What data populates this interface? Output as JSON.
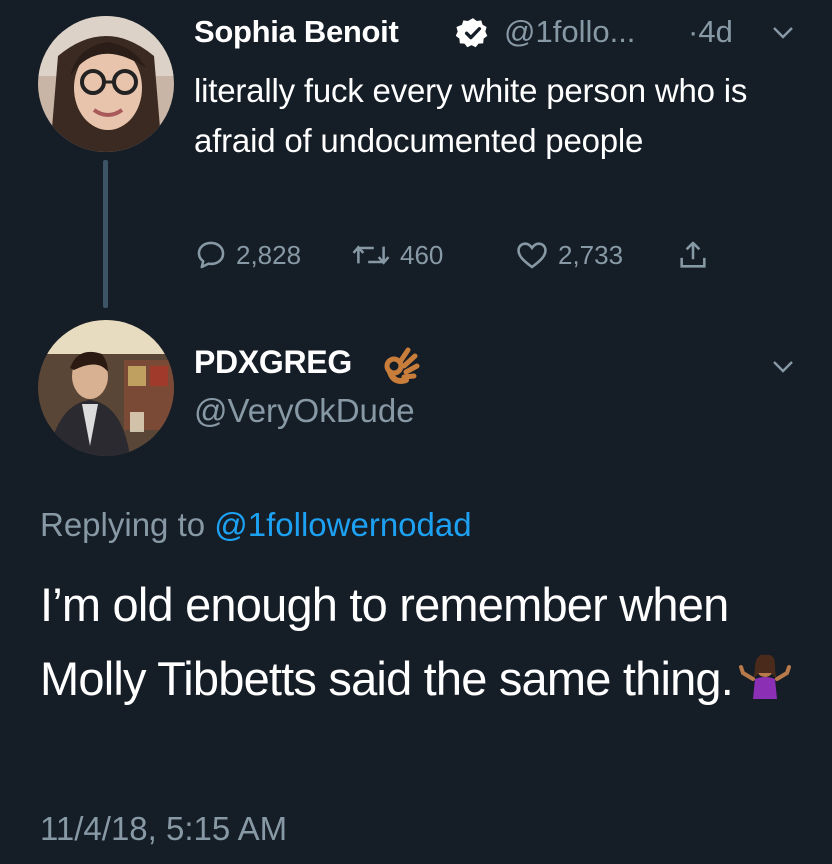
{
  "original_tweet": {
    "author_name": "Sophia Benoit",
    "handle": "@1follo...",
    "time": "·4d",
    "text": "literally fuck every white person who is afraid of undocumented people",
    "replies": "2,828",
    "retweets": "460",
    "likes": "2,733",
    "avatar_icon": "avatar-woman-glasses",
    "verified_icon": "verified-badge-icon"
  },
  "reply_tweet": {
    "author_name": "PDXGREG",
    "name_emoji": "ok-hand-emoji",
    "handle": "@VeryOkDude",
    "replying_prefix": "Replying to ",
    "replying_mention": "@1followernodad",
    "text": "I’m old enough to remember when Molly Tibbetts said the same thing.",
    "text_emoji": "person-shrugging-emoji",
    "timestamp": "11/4/18, 5:15 AM",
    "avatar_icon": "avatar-man-suit"
  },
  "colors": {
    "background": "#151d27",
    "muted": "#8899a6",
    "link": "#1da1f2",
    "thread_line": "#3d5466"
  }
}
